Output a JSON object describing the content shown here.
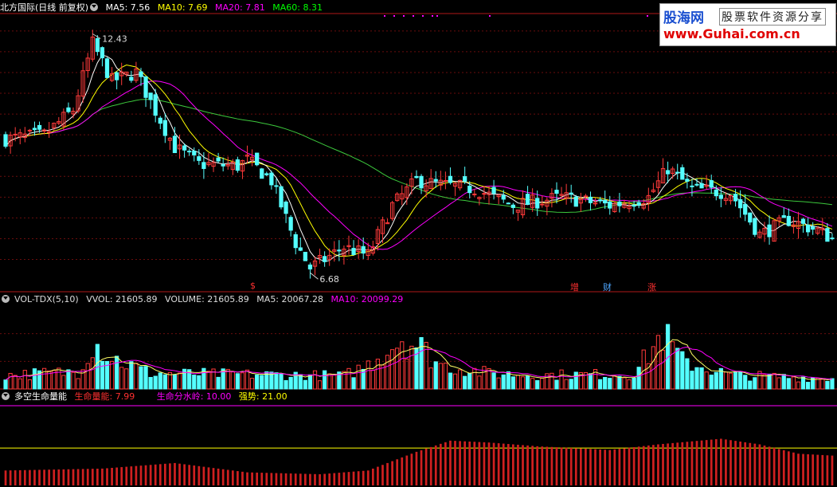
{
  "main_panel": {
    "stock_name": "北方国际(日线 前复权)",
    "indicators": [
      {
        "label": "MA5: 7.56",
        "color": "#ffffff"
      },
      {
        "label": "MA10: 7.69",
        "color": "#ffff00"
      },
      {
        "label": "MA20: 7.81",
        "color": "#ff00ff"
      },
      {
        "label": "MA60: 8.31",
        "color": "#00ff00"
      }
    ],
    "high_label": "12.43",
    "low_label": "6.68",
    "events": [
      {
        "label": "$",
        "color": "#ff3030"
      },
      {
        "label": "增",
        "color": "#ff3030"
      },
      {
        "label": "财",
        "color": "#4da6ff"
      },
      {
        "label": "涨",
        "color": "#ff3030"
      }
    ]
  },
  "volume_panel": {
    "name": "VOL-TDX(5,10)",
    "indicators": [
      {
        "label": "VVOL: 21605.89",
        "color": "#ffffff"
      },
      {
        "label": "VOLUME: 21605.89",
        "color": "#ffffff"
      },
      {
        "label": "MA5: 20067.28",
        "color": "#ffffff"
      },
      {
        "label": "MA10: 20099.29",
        "color": "#ff00ff"
      }
    ]
  },
  "life_panel": {
    "name": "多空生命量能",
    "indicators": [
      {
        "label": "生命量能: 7.99",
        "color": "#ff3030"
      },
      {
        "label": "生命分水岭: 10.00",
        "color": "#ff00ff"
      },
      {
        "label": "强势: 21.00",
        "color": "#ffff00"
      }
    ]
  },
  "logo": {
    "site_name": "股海网",
    "slogan": "股票软件资源分享",
    "url": "www.Guhai.com.cn"
  },
  "colors": {
    "up": "#ff3a3a",
    "down": "#54ffff",
    "ma60": "#3cc83c"
  },
  "chart_data": {
    "type": "candlestick",
    "price_ylim": [
      6.3,
      12.9
    ],
    "price_high": 12.43,
    "price_low": 6.68,
    "bar_count": 172,
    "close_anchors": [
      [
        0,
        9.9
      ],
      [
        8,
        10.0
      ],
      [
        14,
        10.6
      ],
      [
        18,
        12.2
      ],
      [
        22,
        11.3
      ],
      [
        27,
        11.5
      ],
      [
        30,
        10.8
      ],
      [
        35,
        9.7
      ],
      [
        40,
        9.3
      ],
      [
        48,
        9.25
      ],
      [
        50,
        9.4
      ],
      [
        55,
        8.9
      ],
      [
        60,
        7.4
      ],
      [
        63,
        6.8
      ],
      [
        66,
        7.0
      ],
      [
        70,
        7.3
      ],
      [
        75,
        7.1
      ],
      [
        80,
        8.3
      ],
      [
        85,
        8.9
      ],
      [
        90,
        8.8
      ],
      [
        97,
        8.7
      ],
      [
        105,
        8.3
      ],
      [
        115,
        8.5
      ],
      [
        125,
        8.3
      ],
      [
        133,
        8.5
      ],
      [
        137,
        9.2
      ],
      [
        142,
        8.7
      ],
      [
        150,
        8.6
      ],
      [
        156,
        7.6
      ],
      [
        162,
        7.95
      ],
      [
        168,
        7.7
      ],
      [
        171,
        7.5
      ]
    ],
    "volume_anchors": [
      [
        0,
        4000
      ],
      [
        15,
        5000
      ],
      [
        18,
        14000
      ],
      [
        22,
        9000
      ],
      [
        30,
        4500
      ],
      [
        60,
        4000
      ],
      [
        70,
        3800
      ],
      [
        75,
        7000
      ],
      [
        82,
        15000
      ],
      [
        86,
        12000
      ],
      [
        90,
        7000
      ],
      [
        100,
        4500
      ],
      [
        110,
        4000
      ],
      [
        130,
        4300
      ],
      [
        136,
        16000
      ],
      [
        140,
        8000
      ],
      [
        150,
        4000
      ],
      [
        171,
        3000
      ]
    ],
    "volume_ylim": [
      0,
      24000
    ],
    "life_anchors": [
      [
        0,
        4.0
      ],
      [
        20,
        4.5
      ],
      [
        35,
        6.0
      ],
      [
        50,
        3.5
      ],
      [
        65,
        3.0
      ],
      [
        75,
        4.0
      ],
      [
        85,
        9.0
      ],
      [
        92,
        12.0
      ],
      [
        100,
        11.5
      ],
      [
        110,
        10.5
      ],
      [
        125,
        9.5
      ],
      [
        135,
        11.0
      ],
      [
        148,
        12.5
      ],
      [
        156,
        11.0
      ],
      [
        164,
        8.5
      ],
      [
        171,
        7.99
      ]
    ],
    "life_ylim": [
      0,
      22
    ],
    "life_watershed": 10.0,
    "life_strong": 21.0
  }
}
